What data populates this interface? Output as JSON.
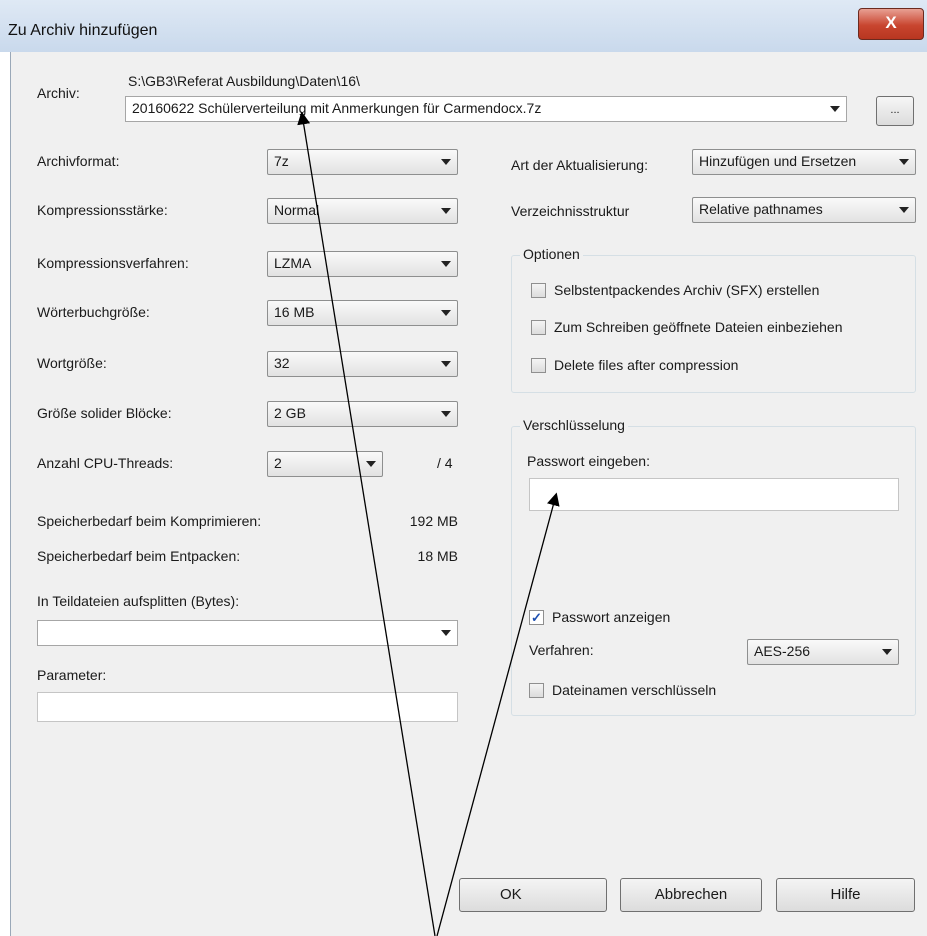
{
  "window": {
    "title": "Zu Archiv hinzufügen",
    "close_glyph": "X"
  },
  "archive": {
    "label": "Archiv:",
    "path": "S:\\GB3\\Referat Ausbildung\\Daten\\16\\",
    "filename": "20160622 Schülerverteilung mit Anmerkungen für Carmendocx.7z",
    "browse_label": "..."
  },
  "left": {
    "format_label": "Archivformat:",
    "format_value": "7z",
    "level_label": "Kompressionsstärke:",
    "level_value": "Normal",
    "method_label": "Kompressionsverfahren:",
    "method_value": "LZMA",
    "dict_label": "Wörterbuchgröße:",
    "dict_value": "16 MB",
    "word_label": "Wortgröße:",
    "word_value": "32",
    "solid_label": "Größe solider Blöcke:",
    "solid_value": "2 GB",
    "threads_label": "Anzahl CPU-Threads:",
    "threads_value": "2",
    "threads_max": "/ 4",
    "mem_compress_label": "Speicherbedarf beim Komprimieren:",
    "mem_compress_value": "192 MB",
    "mem_decompress_label": "Speicherbedarf beim Entpacken:",
    "mem_decompress_value": "18 MB",
    "split_label": "In Teildateien aufsplitten (Bytes):",
    "split_value": "",
    "params_label": "Parameter:",
    "params_value": ""
  },
  "right": {
    "update_label": "Art der Aktualisierung:",
    "update_value": "Hinzufügen und Ersetzen",
    "paths_label": "Verzeichnisstruktur",
    "paths_value": "Relative pathnames",
    "options": {
      "title": "Optionen",
      "sfx": "Selbstentpackendes Archiv (SFX) erstellen",
      "shared": "Zum Schreiben geöffnete Dateien einbeziehen",
      "delete": "Delete files after compression"
    },
    "encryption": {
      "title": "Verschlüsselung",
      "password_label": "Passwort eingeben:",
      "password_value": "",
      "show_password": "Passwort anzeigen",
      "show_password_checked": true,
      "method_label": "Verfahren:",
      "method_value": "AES-256",
      "encrypt_names": "Dateinamen verschlüsseln"
    }
  },
  "buttons": {
    "ok": "OK",
    "cancel": "Abbrechen",
    "help": "Hilfe"
  }
}
